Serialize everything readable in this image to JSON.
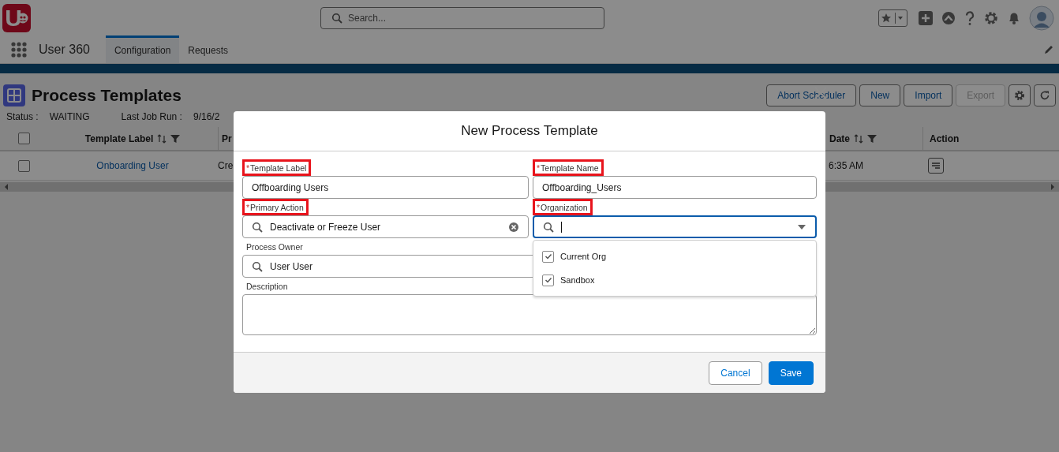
{
  "app": {
    "logo_text": "U",
    "name": "User 360"
  },
  "header": {
    "search": {
      "placeholder": "Search..."
    }
  },
  "nav_tabs": [
    {
      "label": "Configuration",
      "selected": true
    },
    {
      "label": "Requests",
      "selected": false
    }
  ],
  "page": {
    "title": "Process Templates",
    "buttons": [
      {
        "label": "Abort Scheduler",
        "disabled": false
      },
      {
        "label": "New",
        "disabled": false
      },
      {
        "label": "Import",
        "disabled": false
      },
      {
        "label": "Export",
        "disabled": true
      }
    ],
    "status": [
      {
        "label": "Status :",
        "value": "WAITING"
      },
      {
        "label": "Last Job Run :",
        "value": "9/16/2"
      }
    ]
  },
  "table": {
    "all_checked": false,
    "columns": [
      {
        "label": "Template Label",
        "sortable": true
      },
      {
        "label": "Pr",
        "sortable": false
      },
      {
        "label": "Date",
        "sortable": true
      },
      {
        "label": "Action",
        "sortable": false
      }
    ],
    "rows": [
      {
        "checked": false,
        "cells": [
          "Onboarding User",
          "Cre",
          "6:35 AM"
        ]
      }
    ]
  },
  "modal": {
    "title": "New Process Template",
    "fields": [
      {
        "kind": "text",
        "required_mark": "*",
        "label": "Template Label",
        "highlighted": true,
        "value": "Offboarding Users"
      },
      {
        "kind": "text",
        "required_mark": "*",
        "label": "Template Name",
        "highlighted": true,
        "value": "Offboarding_Users"
      },
      {
        "kind": "lookup",
        "required_mark": "*",
        "label": "Primary Action",
        "highlighted": true,
        "value": "Deactivate or Freeze User",
        "clearable": true
      },
      {
        "kind": "combobox",
        "required_mark": "*",
        "label": "Organization",
        "highlighted": true,
        "focused": true,
        "options": [
          {
            "label": "Current Org",
            "checked": true
          },
          {
            "label": "Sandbox",
            "checked": true
          }
        ]
      },
      {
        "kind": "lookup",
        "label": "Process Owner",
        "highlighted": false,
        "value": "User User",
        "clearable": false
      },
      {
        "kind": "textarea",
        "label": "Description",
        "highlighted": false
      }
    ],
    "buttons": [
      {
        "label": "Cancel",
        "kind": "neutral"
      },
      {
        "label": "Save",
        "kind": "brand"
      }
    ]
  }
}
